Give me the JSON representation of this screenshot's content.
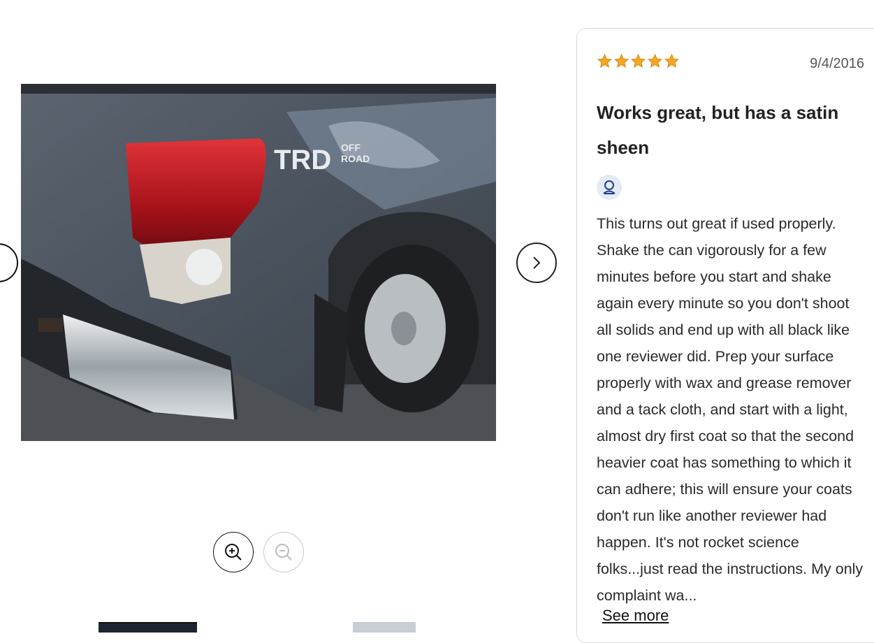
{
  "gallery": {
    "photo_alt": "Gray pickup truck rear quarter with TRD OFF-ROAD decal",
    "decal_text": [
      "TRD",
      "OFF",
      "ROAD"
    ],
    "zoom_in_icon": "zoom-in-icon",
    "zoom_out_icon": "zoom-out-icon",
    "next_icon": "chevron-right-icon"
  },
  "review": {
    "rating": 5,
    "rating_max": 5,
    "star_color": "#f5a623",
    "date": "9/4/2016",
    "title": "Works great, but has a satin sheen",
    "avatar_icon": "user-icon",
    "body": "This turns out great if used properly. Shake the can vigorously for a few minutes before you start and shake again every minute so you don't shoot all solids and end up with all black like one reviewer did. Prep your surface properly with wax and grease remover and a tack cloth, and start with a light, almost dry first coat so that the second heavier coat has something to which it can adhere; this will ensure your coats don't run like another reviewer had happen. It's not rocket science folks...just read the instructions. My only complaint wa...",
    "see_more": "See more"
  }
}
